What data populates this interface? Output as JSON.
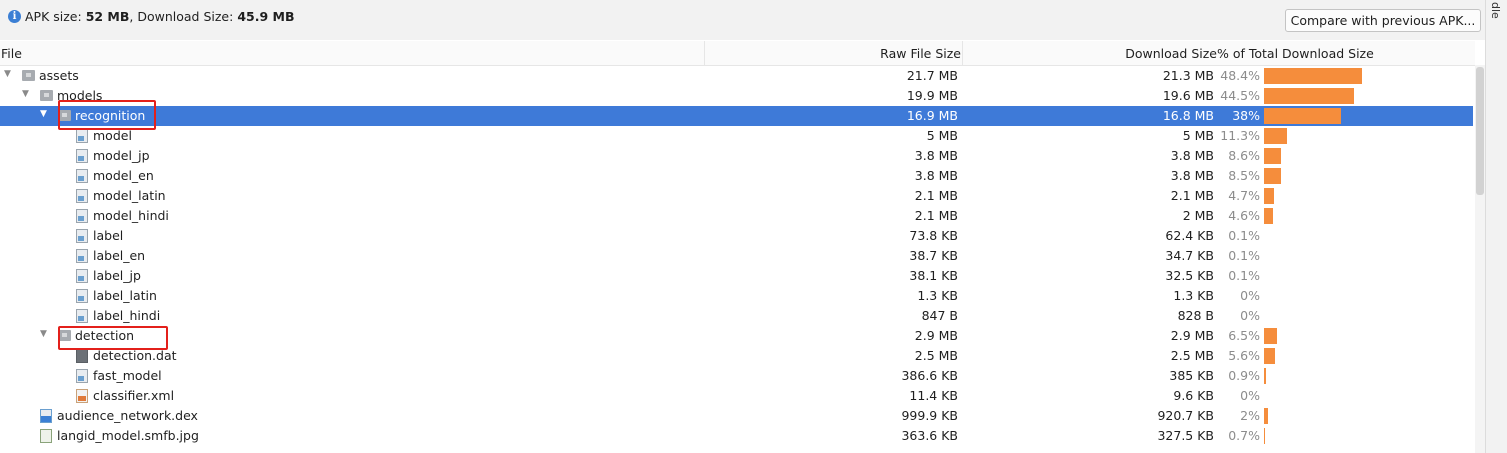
{
  "summary": {
    "apk_label": "APK size: ",
    "apk_value": "52 MB",
    "sep": ", Download Size: ",
    "download_value": "45.9 MB"
  },
  "compare_button": "Compare with previous APK...",
  "right_strip_label": "dle",
  "columns": {
    "file": "File",
    "raw": "Raw File Size",
    "download": "Download Size",
    "percent": "% of Total Download Size"
  },
  "colors": {
    "selection": "#3e7ad8",
    "bar": "#f58d3c",
    "highlight_box": "#e3201b"
  },
  "rows": [
    {
      "name": "assets",
      "depth": 0,
      "icon": "folder-icon",
      "expanded": true,
      "raw": "21.7 MB",
      "download": "21.3 MB",
      "percent": "48.4%",
      "fraction": 0.484
    },
    {
      "name": "models",
      "depth": 1,
      "icon": "folder-icon",
      "expanded": true,
      "raw": "19.9 MB",
      "download": "19.6 MB",
      "percent": "44.5%",
      "fraction": 0.445
    },
    {
      "name": "recognition",
      "depth": 2,
      "icon": "folder-icon",
      "expanded": true,
      "selected": true,
      "raw": "16.9 MB",
      "download": "16.8 MB",
      "percent": "38%",
      "fraction": 0.38
    },
    {
      "name": "model",
      "depth": 3,
      "icon": "file-icon",
      "raw": "5 MB",
      "download": "5 MB",
      "percent": "11.3%",
      "fraction": 0.113
    },
    {
      "name": "model_jp",
      "depth": 3,
      "icon": "file-icon",
      "raw": "3.8 MB",
      "download": "3.8 MB",
      "percent": "8.6%",
      "fraction": 0.086
    },
    {
      "name": "model_en",
      "depth": 3,
      "icon": "file-icon",
      "raw": "3.8 MB",
      "download": "3.8 MB",
      "percent": "8.5%",
      "fraction": 0.085
    },
    {
      "name": "model_latin",
      "depth": 3,
      "icon": "file-icon",
      "raw": "2.1 MB",
      "download": "2.1 MB",
      "percent": "4.7%",
      "fraction": 0.047
    },
    {
      "name": "model_hindi",
      "depth": 3,
      "icon": "file-icon",
      "raw": "2.1 MB",
      "download": "2 MB",
      "percent": "4.6%",
      "fraction": 0.046
    },
    {
      "name": "label",
      "depth": 3,
      "icon": "file-icon",
      "raw": "73.8 KB",
      "download": "62.4 KB",
      "percent": "0.1%",
      "fraction": 0.001
    },
    {
      "name": "label_en",
      "depth": 3,
      "icon": "file-icon",
      "raw": "38.7 KB",
      "download": "34.7 KB",
      "percent": "0.1%",
      "fraction": 0.001
    },
    {
      "name": "label_jp",
      "depth": 3,
      "icon": "file-icon",
      "raw": "38.1 KB",
      "download": "32.5 KB",
      "percent": "0.1%",
      "fraction": 0.001
    },
    {
      "name": "label_latin",
      "depth": 3,
      "icon": "file-icon",
      "raw": "1.3 KB",
      "download": "1.3 KB",
      "percent": "0%",
      "fraction": 0
    },
    {
      "name": "label_hindi",
      "depth": 3,
      "icon": "file-icon",
      "raw": "847 B",
      "download": "828 B",
      "percent": "0%",
      "fraction": 0
    },
    {
      "name": "detection",
      "depth": 2,
      "icon": "folder-icon",
      "expanded": true,
      "raw": "2.9 MB",
      "download": "2.9 MB",
      "percent": "6.5%",
      "fraction": 0.065
    },
    {
      "name": "detection.dat",
      "depth": 3,
      "icon": "dat-file-icon",
      "raw": "2.5 MB",
      "download": "2.5 MB",
      "percent": "5.6%",
      "fraction": 0.056
    },
    {
      "name": "fast_model",
      "depth": 3,
      "icon": "file-icon",
      "raw": "386.6 KB",
      "download": "385 KB",
      "percent": "0.9%",
      "fraction": 0.009
    },
    {
      "name": "classifier.xml",
      "depth": 3,
      "icon": "xml-file-icon",
      "raw": "11.4 KB",
      "download": "9.6 KB",
      "percent": "0%",
      "fraction": 0
    },
    {
      "name": "audience_network.dex",
      "depth": 1,
      "icon": "dex-file-icon",
      "raw": "999.9 KB",
      "download": "920.7 KB",
      "percent": "2%",
      "fraction": 0.02
    },
    {
      "name": "langid_model.smfb.jpg",
      "depth": 1,
      "icon": "image-file-icon",
      "raw": "363.6 KB",
      "download": "327.5 KB",
      "percent": "0.7%",
      "fraction": 0.007
    }
  ]
}
